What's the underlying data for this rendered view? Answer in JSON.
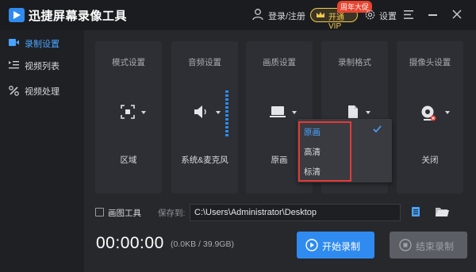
{
  "app": {
    "title": "迅捷屏幕录像工具"
  },
  "header": {
    "login_label": "登录/注册",
    "vip_label": "开通VIP",
    "promo_badge": "周年大促",
    "settings_label": "设置"
  },
  "sidebar": {
    "items": [
      {
        "label": "录制设置",
        "active": true,
        "icon": "video-camera-icon"
      },
      {
        "label": "视频列表",
        "active": false,
        "icon": "list-icon"
      },
      {
        "label": "视频处理",
        "active": false,
        "icon": "tools-icon"
      }
    ]
  },
  "cards": [
    {
      "title": "模式设置",
      "value": "区域",
      "icon": "region-select-icon"
    },
    {
      "title": "音频设置",
      "value": "系统&麦克风",
      "icon": "speaker-icon"
    },
    {
      "title": "画质设置",
      "value": "原画",
      "icon": "monitor-icon"
    },
    {
      "title": "录制格式",
      "value": "",
      "icon": "file-icon"
    },
    {
      "title": "摄像头设置",
      "value": "关闭",
      "icon": "webcam-icon"
    }
  ],
  "quality_dropdown": {
    "options": [
      "原画",
      "高清",
      "标清"
    ],
    "selected": "原画"
  },
  "bottom": {
    "draw_tool_label": "画图工具",
    "draw_tool_checked": false,
    "save_to_label": "保存到:",
    "save_path": "C:\\Users\\Administrator\\Desktop",
    "timer": "00:00:00",
    "file_size": "(0.0KB / 39.9GB)",
    "start_label": "开始录制",
    "stop_label": "结束录制"
  },
  "colors": {
    "accent": "#2f8bf0",
    "active_text": "#4aa3ff",
    "vip_gold": "#f2c94c",
    "promo_red": "#e8442f",
    "highlight_red": "#e53935"
  }
}
